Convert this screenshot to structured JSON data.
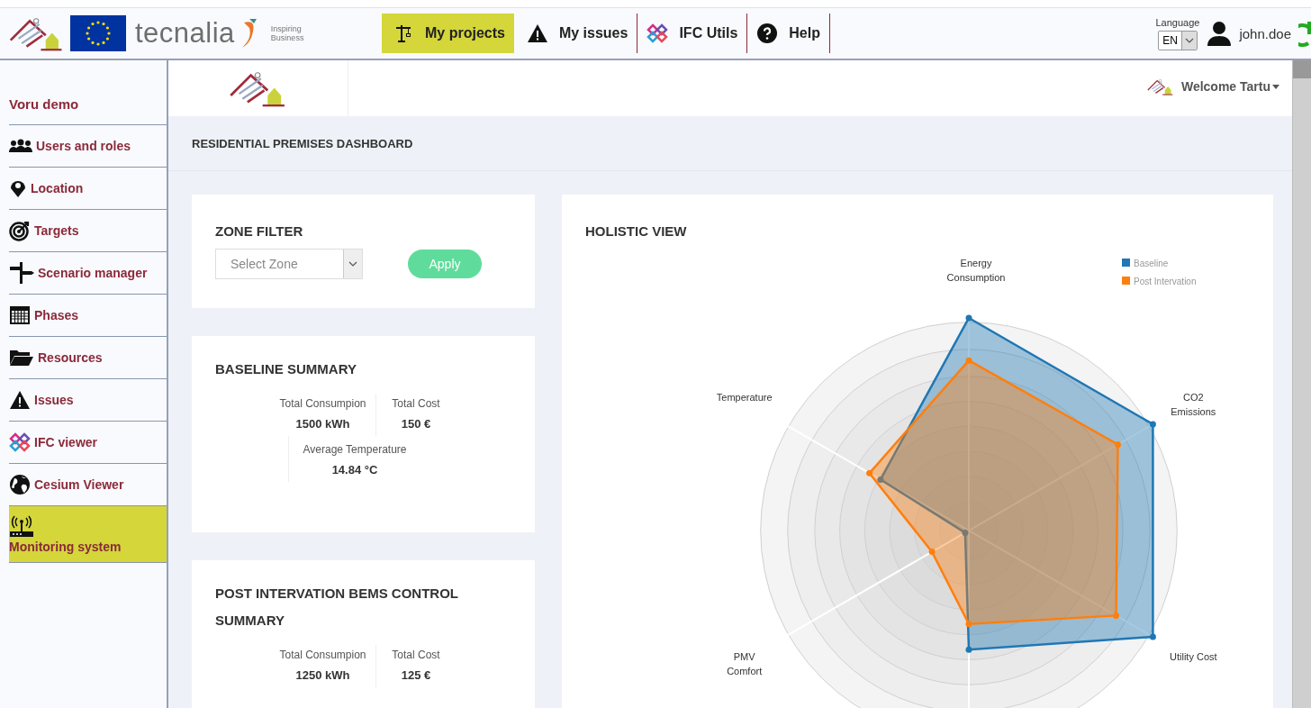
{
  "header": {
    "brand": {
      "name": "tecnalia",
      "tagline": "Inspiring Business"
    },
    "nav": [
      {
        "label": "My projects",
        "selected": true
      },
      {
        "label": "My issues",
        "selected": false
      },
      {
        "label": "IFC Utils",
        "selected": false
      },
      {
        "label": "Help",
        "selected": false
      }
    ],
    "language": {
      "label": "Language",
      "value": "EN"
    },
    "user": "john.doe"
  },
  "sidebar": {
    "project": "Voru demo",
    "items": [
      {
        "label": "Users and roles",
        "selected": false
      },
      {
        "label": "Location",
        "selected": false
      },
      {
        "label": "Targets",
        "selected": false
      },
      {
        "label": "Scenario manager",
        "selected": false
      },
      {
        "label": "Phases",
        "selected": false
      },
      {
        "label": "Resources",
        "selected": false
      },
      {
        "label": "Issues",
        "selected": false
      },
      {
        "label": "IFC viewer",
        "selected": false
      },
      {
        "label": "Cesium Viewer",
        "selected": false
      },
      {
        "label": "Monitoring system",
        "selected": true
      }
    ]
  },
  "topbar": {
    "welcome": "Welcome Tartu"
  },
  "page_title": "RESIDENTIAL PREMISES DASHBOARD",
  "zone_filter": {
    "title": "ZONE FILTER",
    "select": {
      "placeholder": "Select Zone"
    },
    "button": "Apply"
  },
  "summaries": [
    {
      "title": "BASELINE SUMMARY",
      "stats": [
        {
          "label": "Total Consumpion",
          "value": "1500 kWh"
        },
        {
          "label": "Total Cost",
          "value": "150 €"
        },
        {
          "label": "Average Temperature",
          "value": "14.84 °C"
        }
      ]
    },
    {
      "title": "POST INTERVATION BEMS CONTROL SUMMARY",
      "stats": [
        {
          "label": "Total Consumpion",
          "value": "1250 kWh"
        },
        {
          "label": "Total Cost",
          "value": "125 €"
        }
      ]
    }
  ],
  "holistic_view": {
    "title": "HOLISTIC VIEW",
    "axes": [
      {
        "label": "Energy Consumption"
      },
      {
        "label": "Temperature"
      },
      {
        "label": "CO2 Emissions"
      },
      {
        "label": "PMV Comfort"
      },
      {
        "label": "Utility Cost"
      }
    ],
    "legend": [
      {
        "name": "Baseline",
        "color": "#1f77b4"
      },
      {
        "name": "Post Intervation",
        "color": "#ff7f0e"
      }
    ]
  }
}
